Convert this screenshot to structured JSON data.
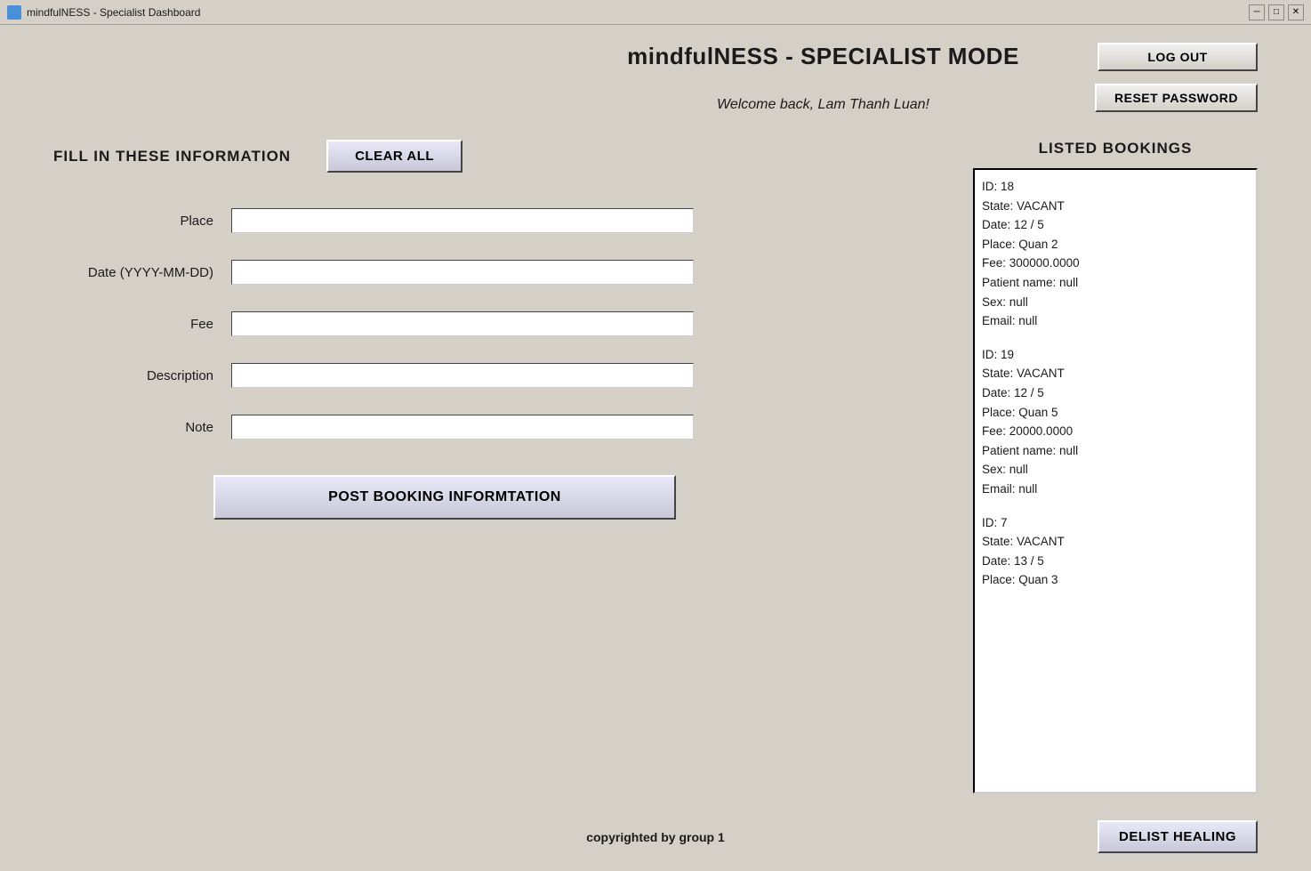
{
  "titlebar": {
    "title": "mindfulNESS - Specialist Dashboard",
    "min_label": "─",
    "max_label": "□",
    "close_label": "✕"
  },
  "header": {
    "app_title": "mindfulNESS - SPECIALIST MODE",
    "welcome_text": "Welcome back, Lam Thanh Luan!",
    "log_out_label": "LOG OUT",
    "reset_password_label": "RESET PASSWORD"
  },
  "form": {
    "section_title": "FILL IN THESE INFORMATION",
    "clear_all_label": "CLEAR ALL",
    "fields": [
      {
        "label": "Place",
        "placeholder": ""
      },
      {
        "label": "Date (YYYY-MM-DD)",
        "placeholder": ""
      },
      {
        "label": "Fee",
        "placeholder": ""
      },
      {
        "label": "Description",
        "placeholder": ""
      },
      {
        "label": "Note",
        "placeholder": ""
      }
    ],
    "post_button_label": "POST BOOKING INFORMTATION"
  },
  "bookings_panel": {
    "title": "LISTED BOOKINGS",
    "entries": [
      {
        "id": "ID: 18",
        "state": "State: VACANT",
        "date": "Date: 12 / 5",
        "place": "Place: Quan 2",
        "fee": "Fee: 300000.0000",
        "patient_name": "Patient name: null",
        "sex": "Sex: null",
        "email": "Email: null"
      },
      {
        "id": "ID: 19",
        "state": "State: VACANT",
        "date": "Date: 12 / 5",
        "place": "Place: Quan 5",
        "fee": "Fee: 20000.0000",
        "patient_name": "Patient name: null",
        "sex": "Sex: null",
        "email": "Email: null"
      },
      {
        "id": "ID: 7",
        "state": "State: VACANT",
        "date": "Date: 13 / 5",
        "place": "Place: Quan 3",
        "fee": "",
        "patient_name": "",
        "sex": "",
        "email": ""
      }
    ]
  },
  "footer": {
    "copyright": "copyrighted by group 1",
    "delist_label": "DELIST HEALING"
  }
}
